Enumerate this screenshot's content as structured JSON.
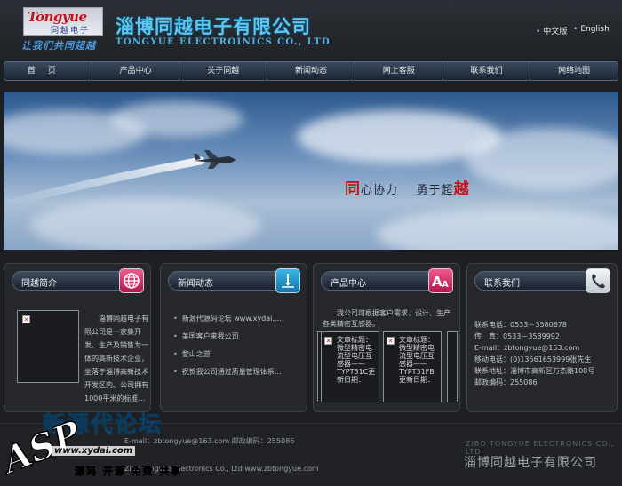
{
  "header": {
    "logo_en": "Tongyue",
    "logo_cn": "同越电子",
    "slogan": "让我们共同超越",
    "company_cn": "淄博同越电子有限公司",
    "company_en": "TONGYUE ELECTROINICS CO., LTD",
    "lang_cn": "中文版",
    "lang_en": "English"
  },
  "nav": {
    "items": [
      "首页",
      "产品中心",
      "关于同越",
      "新闻动态",
      "网上客服",
      "联系我们",
      "网络地图"
    ]
  },
  "banner": {
    "slogan_a_em": "同",
    "slogan_a_rest": "心协力",
    "slogan_b_rest": "勇于超",
    "slogan_b_em": "越"
  },
  "panels": {
    "intro": {
      "title": "同越简介",
      "text": "淄博同越电子有限公司是一家集开发、生产及销售为一体的高新技术企业，坐落于淄博高新技术开发区内。公司拥有1000平米的标准…"
    },
    "news": {
      "title": "新闻动态",
      "items": [
        "新源代源码论坛 www.xydai.…",
        "美国客户来我公司",
        "婺山之游",
        "祝贺我公司通过质量管理体系…"
      ]
    },
    "products": {
      "title": "产品中心",
      "intro": "我公司可根据客户需求，设计、生产各类精密互感器。",
      "cards": [
        {
          "caption": "文章标题：微型精密电流型电压互感器——TYPT31C更新日期："
        },
        {
          "caption": "文章标题：微型精密电流型电压互感器——TYPT31FB更新日期："
        }
      ]
    },
    "contact": {
      "title": "联系我们",
      "lines": [
        "联系电话：0533－3580678",
        "传　真：0533－3589992",
        "E-mail：zbtongyue@163.com",
        "移动电话：(0)13561653999张先生",
        "联系地址：淄博市高新区万杰路108号",
        "邮政编码：255086"
      ]
    }
  },
  "footer": {
    "line1": "E-mail：zbtongyue@163.com   邮政编码：255086",
    "line2": "Zibo Tongyue Electronics Co., Ltd   www.zbtongyue.com",
    "brand_en": "ZIBO TONGYUE ELECTRONICS CO., LTD",
    "brand_cn": "淄博同越电子有限公司"
  },
  "watermark": {
    "asp": "ASP",
    "cn": "新源代论坛",
    "url": "www.xydai.com",
    "tag": "源码 开源 免费 共享"
  },
  "colors": {
    "accent": "#5cc7f0",
    "page_bg": "#1d1f23",
    "banner_highlight": "#c3131a"
  }
}
